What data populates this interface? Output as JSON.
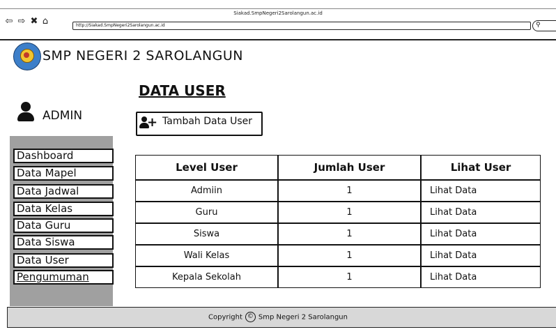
{
  "browser": {
    "window_title": "Siakad.SmpNegeri2Sarolangun.ac.id",
    "url": "http://Siakad.SmpNegeri2Sarolangun.ac.id"
  },
  "header": {
    "school_name": "SMP NEGERI 2 SAROLANGUN"
  },
  "user": {
    "name": "ADMIN"
  },
  "sidebar": {
    "items": [
      {
        "label": "Dashboard"
      },
      {
        "label": "Data Mapel"
      },
      {
        "label": "Data Jadwal"
      },
      {
        "label": "Data Kelas"
      },
      {
        "label": "Data Guru"
      },
      {
        "label": "Data Siswa"
      },
      {
        "label": "Data User"
      },
      {
        "label": "Pengumuman"
      }
    ]
  },
  "main": {
    "title": "DATA USER",
    "add_button_label": "Tambah Data User",
    "table": {
      "headers": [
        "Level User",
        "Jumlah User",
        "Lihat User"
      ],
      "rows": [
        {
          "level": "Admiin",
          "jumlah": "1",
          "lihat": "Lihat Data"
        },
        {
          "level": "Guru",
          "jumlah": "1",
          "lihat": "Lihat Data"
        },
        {
          "level": "Siswa",
          "jumlah": "1",
          "lihat": "Lihat Data"
        },
        {
          "level": "Wali Kelas",
          "jumlah": "1",
          "lihat": "Lihat Data"
        },
        {
          "level": "Kepala Sekolah",
          "jumlah": "1",
          "lihat": "Lihat Data"
        }
      ]
    }
  },
  "footer": {
    "prefix": "Copyright",
    "copyright_symbol": "©",
    "suffix": "Smp Negeri 2 Sarolangun"
  },
  "icons": {
    "back": "back-arrow-icon",
    "forward": "forward-arrow-icon",
    "stop": "close-icon",
    "home": "home-icon",
    "search": "search-icon",
    "user": "user-icon",
    "add_user": "add-user-icon"
  },
  "colors": {
    "sidebar_bg": "#a0a0a0",
    "footer_bg": "#d8d8d8",
    "logo_blue": "#3d7fc9"
  }
}
